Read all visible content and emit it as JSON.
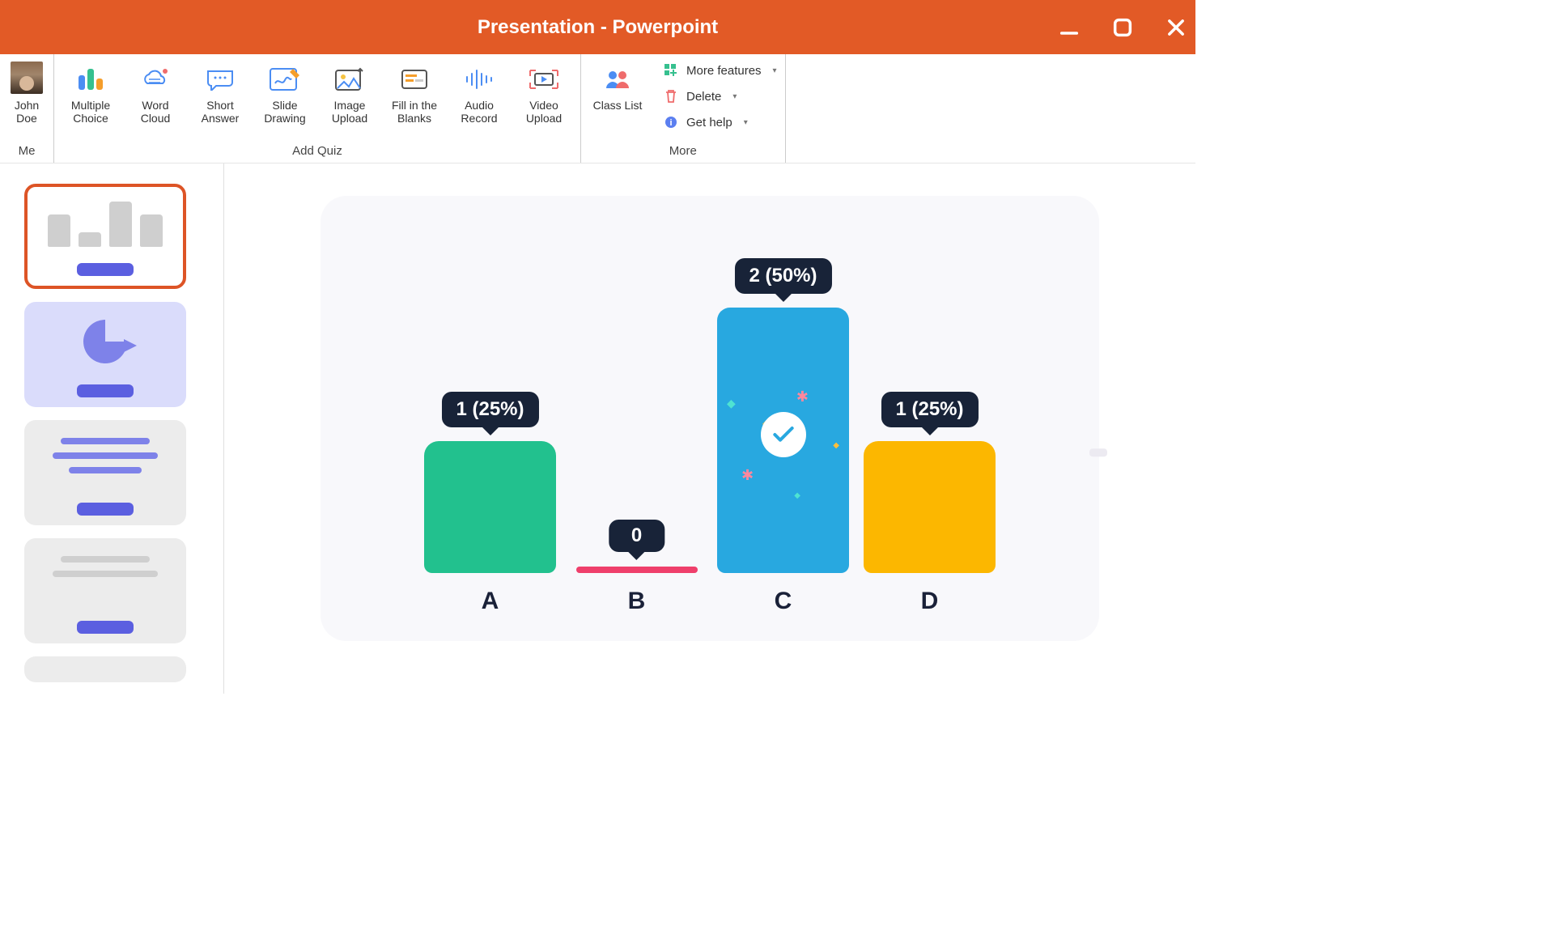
{
  "window": {
    "title": "Presentation - Powerpoint"
  },
  "user": {
    "name": "John Doe"
  },
  "ribbon": {
    "groups": {
      "me": {
        "label": "Me"
      },
      "quiz": {
        "label": "Add Quiz",
        "items": {
          "multiple_choice": "Multiple Choice",
          "word_cloud": "Word Cloud",
          "short_answer": "Short Answer",
          "slide_drawing": "Slide Drawing",
          "image_upload": "Image Upload",
          "fill_blanks": "Fill in the Blanks",
          "audio_record": "Audio Record",
          "video_upload": "Video Upload"
        }
      },
      "more": {
        "label": "More",
        "class_list": "Class List",
        "more_features": "More features",
        "delete": "Delete",
        "get_help": "Get help"
      }
    }
  },
  "chart_data": {
    "type": "bar",
    "categories": [
      "A",
      "B",
      "C",
      "D"
    ],
    "values": [
      1,
      0,
      2,
      1
    ],
    "percentages": [
      25,
      0,
      50,
      25
    ],
    "correct_index": 2,
    "tooltips": {
      "A": "1 (25%)",
      "B": "0",
      "C": "2 (50%)",
      "D": "1 (25%)"
    },
    "colors": {
      "A": "#22c18e",
      "B": "#ef3f6b",
      "C": "#28a8e0",
      "D": "#fcb700"
    },
    "title": "",
    "xlabel": "",
    "ylabel": "",
    "ylim": [
      0,
      2
    ]
  }
}
